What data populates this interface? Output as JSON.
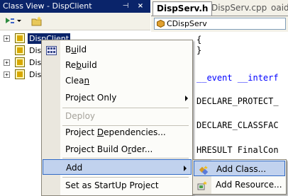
{
  "class_view": {
    "title": "Class View - DispClient",
    "tree_items": [
      {
        "label": "DispClient",
        "selected": true
      },
      {
        "label": "Disp"
      },
      {
        "label": "Disp"
      },
      {
        "label": "Disp"
      }
    ]
  },
  "editor": {
    "tabs": [
      {
        "label": "DispServ.h",
        "active": true
      },
      {
        "label": "DispServ.cpp"
      },
      {
        "label": "oaidl.h"
      }
    ],
    "class_combo": "CDispServ",
    "code_lines": [
      "{",
      "}",
      "__event __interf",
      "DECLARE_PROTECT_",
      "DECLARE_CLASSFAC",
      "HRESULT FinalCon"
    ]
  },
  "context_menu": {
    "items": [
      {
        "label": "Build",
        "underline": 1
      },
      {
        "label": "Rebuild",
        "underline": 2
      },
      {
        "label": "Clean",
        "underline": 4
      },
      {
        "label": "Project Only",
        "submenu": true
      },
      {
        "label": "Deploy",
        "disabled": true
      },
      {
        "label": "Project Dependencies...",
        "underline": 8
      },
      {
        "label": "Project Build Order...",
        "underline": 15
      },
      {
        "label": "Add",
        "submenu": true,
        "highlight": true
      },
      {
        "label": "Set as StartUp Project"
      }
    ]
  },
  "submenu": {
    "items": [
      {
        "label": "Add Class...",
        "highlight": true
      },
      {
        "label": "Add Resource..."
      }
    ]
  },
  "colors": {
    "title_bar": "#0a246a",
    "menu_highlight": "#c1d2ee",
    "menu_highlight_border": "#316ac5",
    "keyword": "#0000ff"
  }
}
